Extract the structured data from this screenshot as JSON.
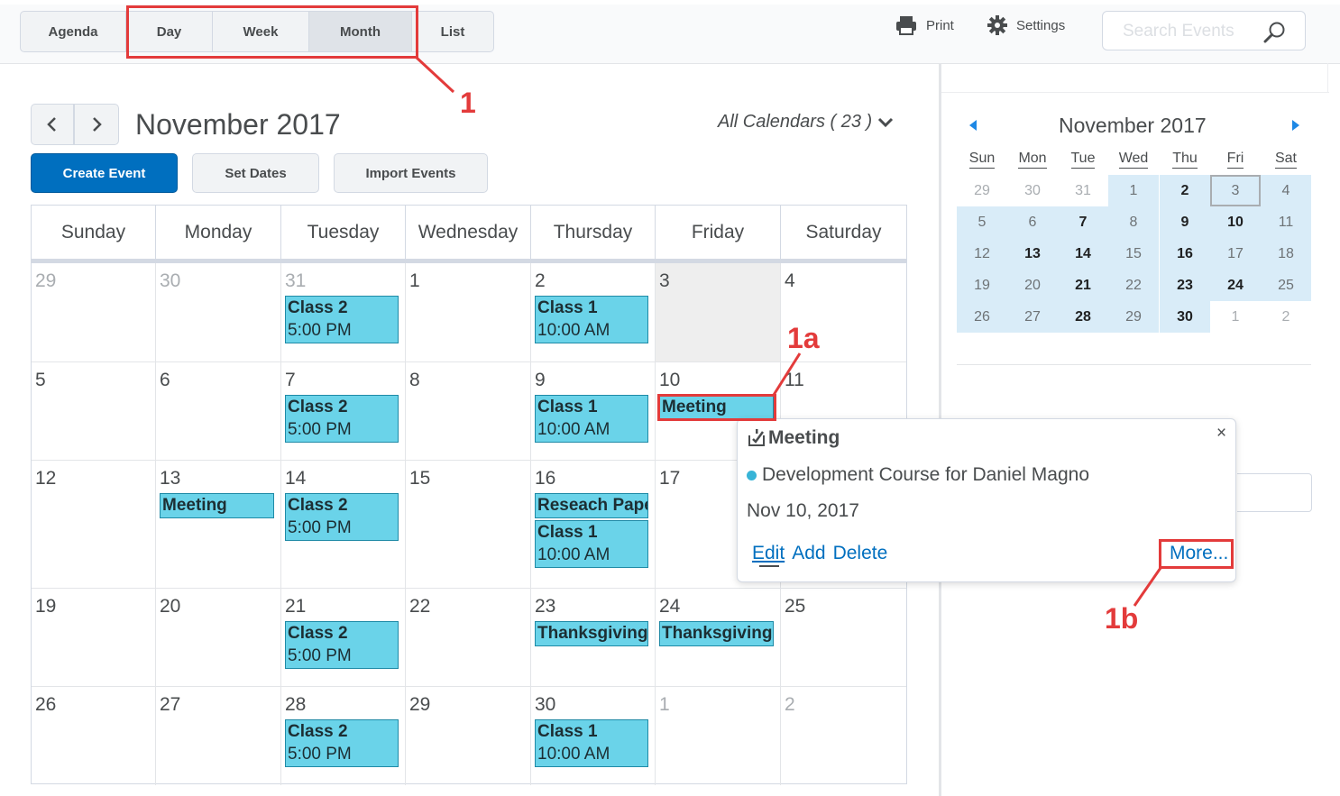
{
  "toolbar": {
    "views": [
      "Agenda",
      "Day",
      "Week",
      "Month",
      "List"
    ],
    "active_view": "Month",
    "print_label": "Print",
    "settings_label": "Settings",
    "search_placeholder": "Search Events"
  },
  "header": {
    "month_title": "November 2017",
    "all_calendars": "All Calendars ( 23 )",
    "create_event": "Create Event",
    "set_dates": "Set Dates",
    "import_events": "Import Events"
  },
  "weekdays": [
    "Sunday",
    "Monday",
    "Tuesday",
    "Wednesday",
    "Thursday",
    "Friday",
    "Saturday"
  ],
  "weeks": [
    [
      {
        "day": "29",
        "out": true,
        "events": []
      },
      {
        "day": "30",
        "out": true,
        "events": []
      },
      {
        "day": "31",
        "out": true,
        "events": [
          {
            "title": "Class 2",
            "time": "5:00 PM"
          }
        ]
      },
      {
        "day": "1",
        "events": []
      },
      {
        "day": "2",
        "events": [
          {
            "title": "Class 1",
            "time": "10:00 AM"
          }
        ]
      },
      {
        "day": "3",
        "today": true,
        "events": []
      },
      {
        "day": "4",
        "events": []
      }
    ],
    [
      {
        "day": "5",
        "events": []
      },
      {
        "day": "6",
        "events": []
      },
      {
        "day": "7",
        "events": [
          {
            "title": "Class 2",
            "time": "5:00 PM"
          }
        ]
      },
      {
        "day": "8",
        "events": []
      },
      {
        "day": "9",
        "events": [
          {
            "title": "Class 1",
            "time": "10:00 AM"
          }
        ]
      },
      {
        "day": "10",
        "events": [
          {
            "title": "Meeting",
            "time": ""
          }
        ]
      },
      {
        "day": "11",
        "events": []
      }
    ],
    [
      {
        "day": "12",
        "events": []
      },
      {
        "day": "13",
        "events": [
          {
            "title": "Meeting",
            "time": ""
          }
        ]
      },
      {
        "day": "14",
        "events": [
          {
            "title": "Class 2",
            "time": "5:00 PM"
          }
        ]
      },
      {
        "day": "15",
        "events": []
      },
      {
        "day": "16",
        "events": [
          {
            "title": "Reseach Paper",
            "time": ""
          },
          {
            "title": "Class 1",
            "time": "10:00 AM"
          }
        ]
      },
      {
        "day": "17",
        "events": []
      },
      {
        "day": "18",
        "events": []
      }
    ],
    [
      {
        "day": "19",
        "events": []
      },
      {
        "day": "20",
        "events": []
      },
      {
        "day": "21",
        "events": [
          {
            "title": "Class 2",
            "time": "5:00 PM"
          }
        ]
      },
      {
        "day": "22",
        "events": []
      },
      {
        "day": "23",
        "events": [
          {
            "title": "Thanksgiving Break",
            "time": ""
          }
        ]
      },
      {
        "day": "24",
        "events": [
          {
            "title": "Thanksgiving Break",
            "time": ""
          }
        ]
      },
      {
        "day": "25",
        "events": []
      }
    ],
    [
      {
        "day": "26",
        "events": []
      },
      {
        "day": "27",
        "events": []
      },
      {
        "day": "28",
        "events": [
          {
            "title": "Class 2",
            "time": "5:00 PM"
          }
        ]
      },
      {
        "day": "29",
        "events": []
      },
      {
        "day": "30",
        "events": [
          {
            "title": "Class 1",
            "time": "10:00 AM"
          }
        ]
      },
      {
        "day": "1",
        "out": true,
        "events": []
      },
      {
        "day": "2",
        "out": true,
        "events": []
      }
    ]
  ],
  "mini": {
    "title": "November 2017",
    "dow": [
      "Sun",
      "Mon",
      "Tue",
      "Wed",
      "Thu",
      "Fri",
      "Sat"
    ],
    "weeks": [
      [
        {
          "d": "29",
          "out": true
        },
        {
          "d": "30",
          "out": true
        },
        {
          "d": "31",
          "out": true
        },
        {
          "d": "1"
        },
        {
          "d": "2",
          "bold": true
        },
        {
          "d": "3",
          "sel": true
        },
        {
          "d": "4"
        }
      ],
      [
        {
          "d": "5"
        },
        {
          "d": "6"
        },
        {
          "d": "7",
          "bold": true
        },
        {
          "d": "8"
        },
        {
          "d": "9",
          "bold": true
        },
        {
          "d": "10",
          "bold": true
        },
        {
          "d": "11"
        }
      ],
      [
        {
          "d": "12"
        },
        {
          "d": "13",
          "bold": true
        },
        {
          "d": "14",
          "bold": true
        },
        {
          "d": "15"
        },
        {
          "d": "16",
          "bold": true
        },
        {
          "d": "17"
        },
        {
          "d": "18"
        }
      ],
      [
        {
          "d": "19"
        },
        {
          "d": "20"
        },
        {
          "d": "21",
          "bold": true
        },
        {
          "d": "22"
        },
        {
          "d": "23",
          "bold": true
        },
        {
          "d": "24",
          "bold": true
        },
        {
          "d": "25"
        }
      ],
      [
        {
          "d": "26"
        },
        {
          "d": "27"
        },
        {
          "d": "28",
          "bold": true
        },
        {
          "d": "29"
        },
        {
          "d": "30",
          "bold": true
        },
        {
          "d": "1",
          "out": true
        },
        {
          "d": "2",
          "out": true
        }
      ]
    ]
  },
  "popup": {
    "title": "Meeting",
    "calendar": "Development Course for Daniel Magno",
    "date": "Nov 10, 2017",
    "edit": "Edit",
    "add": "Add",
    "delete": "Delete",
    "more": "More...",
    "close": "×"
  },
  "annotations": {
    "label_1": "1",
    "label_1a": "1a",
    "label_1b": "1b",
    "color": "#e33b3b"
  },
  "colors": {
    "primary": "#006fbf",
    "event_fill": "#6ad3e9",
    "mini_range": "#d9ecf8"
  }
}
